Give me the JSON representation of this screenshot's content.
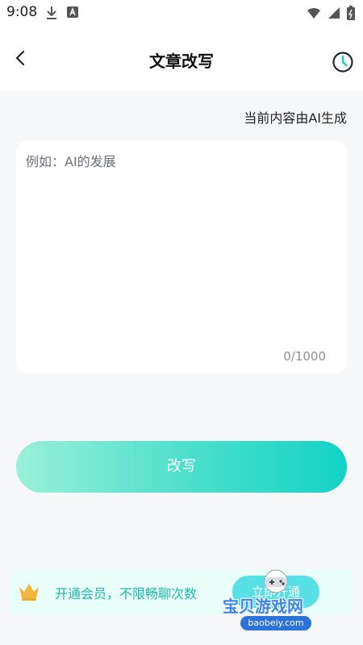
{
  "status_bar": {
    "time": "9:08"
  },
  "header": {
    "title": "文章改写"
  },
  "note": "当前内容由AI生成",
  "editor": {
    "placeholder": "例如：AI的发展",
    "count": "0/1000"
  },
  "action": {
    "rewrite_label": "改写"
  },
  "vip": {
    "text": "开通会员，不限畅聊次数",
    "button_label": "立即开通"
  },
  "watermark": {
    "text": "宝贝游戏网",
    "url": "baobeiy.com"
  },
  "colors": {
    "accent_start": "#9bf0d8",
    "accent_end": "#12d3c5",
    "vip_text": "#1fb8ad"
  }
}
